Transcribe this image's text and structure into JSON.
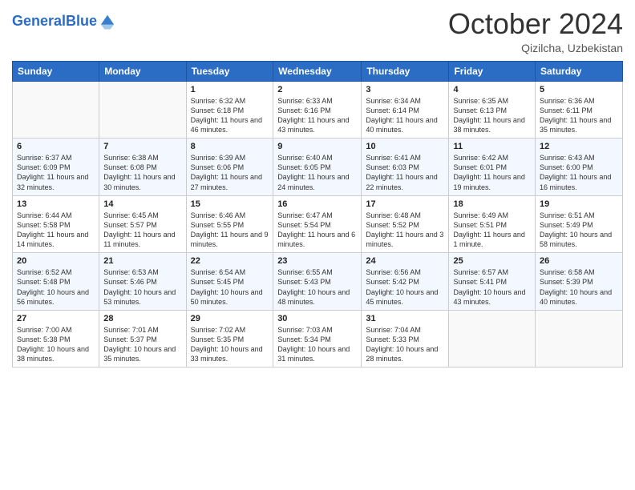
{
  "header": {
    "logo_line1": "General",
    "logo_line2": "Blue",
    "month_title": "October 2024",
    "location": "Qizilcha, Uzbekistan"
  },
  "weekdays": [
    "Sunday",
    "Monday",
    "Tuesday",
    "Wednesday",
    "Thursday",
    "Friday",
    "Saturday"
  ],
  "weeks": [
    [
      {
        "day": "",
        "info": ""
      },
      {
        "day": "",
        "info": ""
      },
      {
        "day": "1",
        "info": "Sunrise: 6:32 AM\nSunset: 6:18 PM\nDaylight: 11 hours and 46 minutes."
      },
      {
        "day": "2",
        "info": "Sunrise: 6:33 AM\nSunset: 6:16 PM\nDaylight: 11 hours and 43 minutes."
      },
      {
        "day": "3",
        "info": "Sunrise: 6:34 AM\nSunset: 6:14 PM\nDaylight: 11 hours and 40 minutes."
      },
      {
        "day": "4",
        "info": "Sunrise: 6:35 AM\nSunset: 6:13 PM\nDaylight: 11 hours and 38 minutes."
      },
      {
        "day": "5",
        "info": "Sunrise: 6:36 AM\nSunset: 6:11 PM\nDaylight: 11 hours and 35 minutes."
      }
    ],
    [
      {
        "day": "6",
        "info": "Sunrise: 6:37 AM\nSunset: 6:09 PM\nDaylight: 11 hours and 32 minutes."
      },
      {
        "day": "7",
        "info": "Sunrise: 6:38 AM\nSunset: 6:08 PM\nDaylight: 11 hours and 30 minutes."
      },
      {
        "day": "8",
        "info": "Sunrise: 6:39 AM\nSunset: 6:06 PM\nDaylight: 11 hours and 27 minutes."
      },
      {
        "day": "9",
        "info": "Sunrise: 6:40 AM\nSunset: 6:05 PM\nDaylight: 11 hours and 24 minutes."
      },
      {
        "day": "10",
        "info": "Sunrise: 6:41 AM\nSunset: 6:03 PM\nDaylight: 11 hours and 22 minutes."
      },
      {
        "day": "11",
        "info": "Sunrise: 6:42 AM\nSunset: 6:01 PM\nDaylight: 11 hours and 19 minutes."
      },
      {
        "day": "12",
        "info": "Sunrise: 6:43 AM\nSunset: 6:00 PM\nDaylight: 11 hours and 16 minutes."
      }
    ],
    [
      {
        "day": "13",
        "info": "Sunrise: 6:44 AM\nSunset: 5:58 PM\nDaylight: 11 hours and 14 minutes."
      },
      {
        "day": "14",
        "info": "Sunrise: 6:45 AM\nSunset: 5:57 PM\nDaylight: 11 hours and 11 minutes."
      },
      {
        "day": "15",
        "info": "Sunrise: 6:46 AM\nSunset: 5:55 PM\nDaylight: 11 hours and 9 minutes."
      },
      {
        "day": "16",
        "info": "Sunrise: 6:47 AM\nSunset: 5:54 PM\nDaylight: 11 hours and 6 minutes."
      },
      {
        "day": "17",
        "info": "Sunrise: 6:48 AM\nSunset: 5:52 PM\nDaylight: 11 hours and 3 minutes."
      },
      {
        "day": "18",
        "info": "Sunrise: 6:49 AM\nSunset: 5:51 PM\nDaylight: 11 hours and 1 minute."
      },
      {
        "day": "19",
        "info": "Sunrise: 6:51 AM\nSunset: 5:49 PM\nDaylight: 10 hours and 58 minutes."
      }
    ],
    [
      {
        "day": "20",
        "info": "Sunrise: 6:52 AM\nSunset: 5:48 PM\nDaylight: 10 hours and 56 minutes."
      },
      {
        "day": "21",
        "info": "Sunrise: 6:53 AM\nSunset: 5:46 PM\nDaylight: 10 hours and 53 minutes."
      },
      {
        "day": "22",
        "info": "Sunrise: 6:54 AM\nSunset: 5:45 PM\nDaylight: 10 hours and 50 minutes."
      },
      {
        "day": "23",
        "info": "Sunrise: 6:55 AM\nSunset: 5:43 PM\nDaylight: 10 hours and 48 minutes."
      },
      {
        "day": "24",
        "info": "Sunrise: 6:56 AM\nSunset: 5:42 PM\nDaylight: 10 hours and 45 minutes."
      },
      {
        "day": "25",
        "info": "Sunrise: 6:57 AM\nSunset: 5:41 PM\nDaylight: 10 hours and 43 minutes."
      },
      {
        "day": "26",
        "info": "Sunrise: 6:58 AM\nSunset: 5:39 PM\nDaylight: 10 hours and 40 minutes."
      }
    ],
    [
      {
        "day": "27",
        "info": "Sunrise: 7:00 AM\nSunset: 5:38 PM\nDaylight: 10 hours and 38 minutes."
      },
      {
        "day": "28",
        "info": "Sunrise: 7:01 AM\nSunset: 5:37 PM\nDaylight: 10 hours and 35 minutes."
      },
      {
        "day": "29",
        "info": "Sunrise: 7:02 AM\nSunset: 5:35 PM\nDaylight: 10 hours and 33 minutes."
      },
      {
        "day": "30",
        "info": "Sunrise: 7:03 AM\nSunset: 5:34 PM\nDaylight: 10 hours and 31 minutes."
      },
      {
        "day": "31",
        "info": "Sunrise: 7:04 AM\nSunset: 5:33 PM\nDaylight: 10 hours and 28 minutes."
      },
      {
        "day": "",
        "info": ""
      },
      {
        "day": "",
        "info": ""
      }
    ]
  ]
}
